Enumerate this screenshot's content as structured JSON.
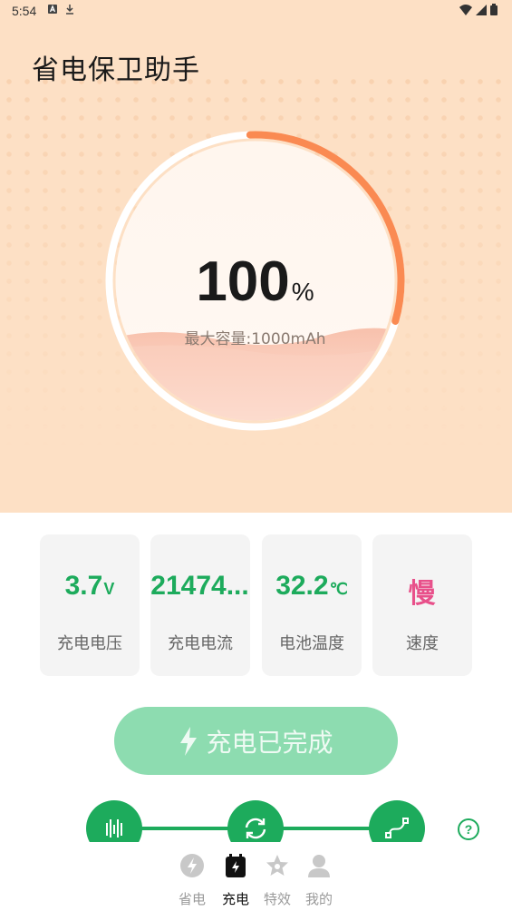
{
  "status_bar": {
    "time": "5:54"
  },
  "app": {
    "title": "省电保卫助手"
  },
  "battery": {
    "percent": "100",
    "percent_unit": "%",
    "capacity_text": "最大容量:1000mAh",
    "ring_progress": 0.3
  },
  "stats": [
    {
      "value": "3.7",
      "unit": "V",
      "label": "充电电压",
      "color": "#1dab5c"
    },
    {
      "value": "21474...",
      "unit": "",
      "label": "充电电流",
      "color": "#1dab5c"
    },
    {
      "value": "32.2",
      "unit": "℃",
      "label": "电池温度",
      "color": "#1dab5c"
    },
    {
      "value": "慢",
      "unit": "",
      "label": "速度",
      "color": "#e8508a"
    }
  ],
  "charge_button": {
    "label": "充电已完成"
  },
  "help": {
    "symbol": "?"
  },
  "tabs": [
    {
      "label": "省电",
      "icon": "bolt-icon",
      "active": false
    },
    {
      "label": "充电",
      "icon": "battery-icon",
      "active": true
    },
    {
      "label": "特效",
      "icon": "star-icon",
      "active": false
    },
    {
      "label": "我的",
      "icon": "user-icon",
      "active": false
    }
  ],
  "colors": {
    "accent": "#1dab5c",
    "ring": "#fa8a52",
    "hero_bg": "#fde0c5"
  }
}
